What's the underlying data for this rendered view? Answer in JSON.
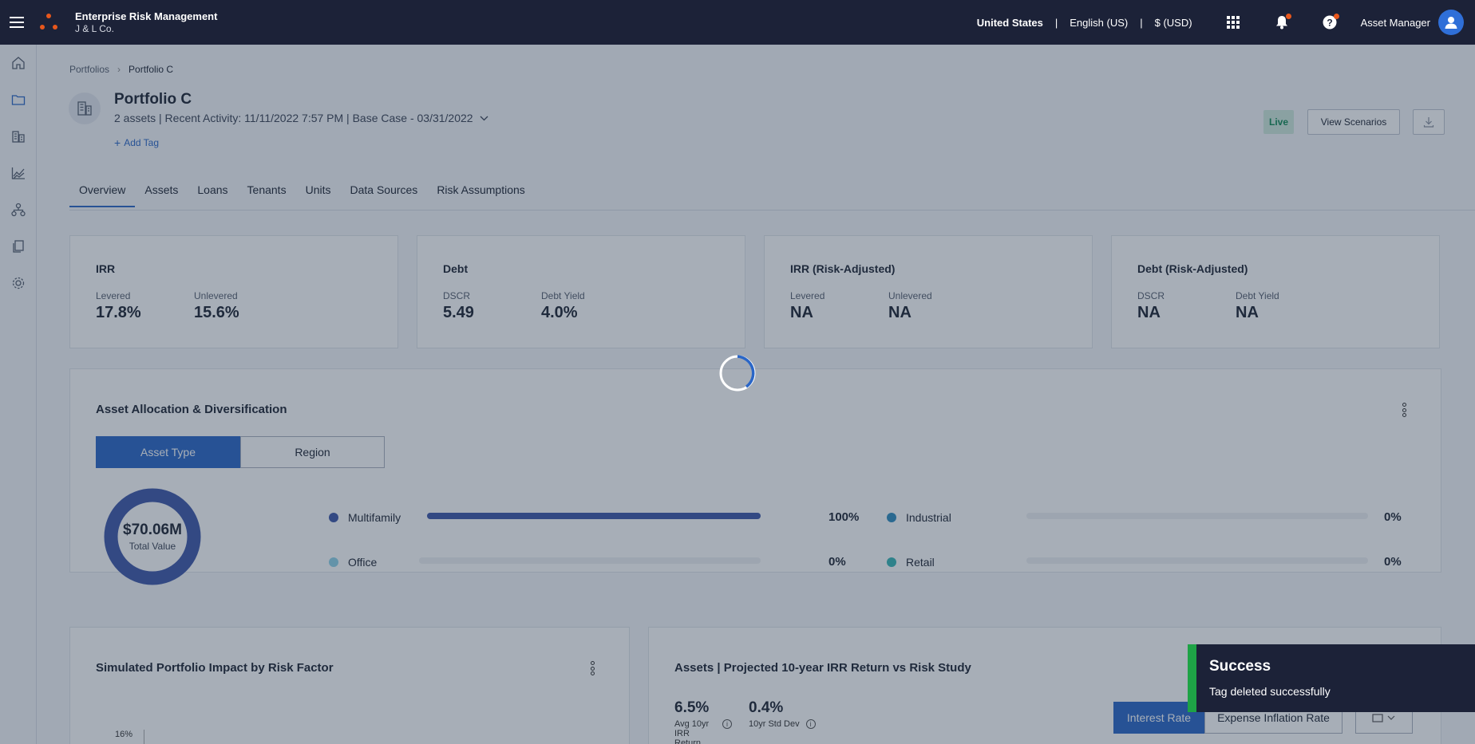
{
  "header": {
    "app_name": "Enterprise Risk Management",
    "company": "J & L Co.",
    "country": "United States",
    "language": "English (US)",
    "currency": "$ (USD)",
    "user_name": "Asset Manager"
  },
  "breadcrumb": {
    "root": "Portfolios",
    "current": "Portfolio C"
  },
  "portfolio": {
    "title": "Portfolio C",
    "subtitle": "2 assets | Recent Activity: 11/11/2022 7:57 PM | Base Case - 03/31/2022",
    "add_tag": "Add Tag",
    "status": "Live",
    "view_scenarios": "View Scenarios"
  },
  "tabs": [
    "Overview",
    "Assets",
    "Loans",
    "Tenants",
    "Units",
    "Data Sources",
    "Risk Assumptions"
  ],
  "metrics": [
    {
      "title": "IRR",
      "l1": "Levered",
      "v1": "17.8%",
      "l2": "Unlevered",
      "v2": "15.6%"
    },
    {
      "title": "Debt",
      "l1": "DSCR",
      "v1": "5.49",
      "l2": "Debt Yield",
      "v2": "4.0%"
    },
    {
      "title": "IRR (Risk-Adjusted)",
      "l1": "Levered",
      "v1": "NA",
      "l2": "Unlevered",
      "v2": "NA"
    },
    {
      "title": "Debt (Risk-Adjusted)",
      "l1": "DSCR",
      "v1": "NA",
      "l2": "Debt Yield",
      "v2": "NA"
    }
  ],
  "allocation": {
    "title": "Asset Allocation & Diversification",
    "toggle_on": "Asset Type",
    "toggle_off": "Region",
    "total_value": "$70.06M",
    "total_label": "Total Value",
    "items": [
      {
        "name": "Multifamily",
        "pct": "100%",
        "share": 1.0,
        "color": "#3e57a8"
      },
      {
        "name": "Industrial",
        "pct": "0%",
        "share": 0,
        "color": "#2f8cbf"
      },
      {
        "name": "Office",
        "pct": "0%",
        "share": 0,
        "color": "#8fd3e8"
      },
      {
        "name": "Retail",
        "pct": "0%",
        "share": 0,
        "color": "#37b6b6"
      }
    ]
  },
  "impact_panel": {
    "title": "Simulated Portfolio Impact by Risk Factor",
    "y_tick": "16%"
  },
  "irr_panel": {
    "title": "Assets | Projected 10-year IRR Return vs Risk Study",
    "avg_value": "6.5%",
    "avg_label": "Avg 10yr IRR Return",
    "std_value": "0.4%",
    "std_label": "10yr Std Dev",
    "btn_interest": "Interest Rate",
    "btn_expense": "Expense Inflation Rate"
  },
  "toast": {
    "title": "Success",
    "message": "Tag deleted successfully"
  },
  "colors": {
    "accent": "#2a66c7",
    "topbar": "#1c2238",
    "success": "#1ea346",
    "notify": "#e8571c"
  }
}
